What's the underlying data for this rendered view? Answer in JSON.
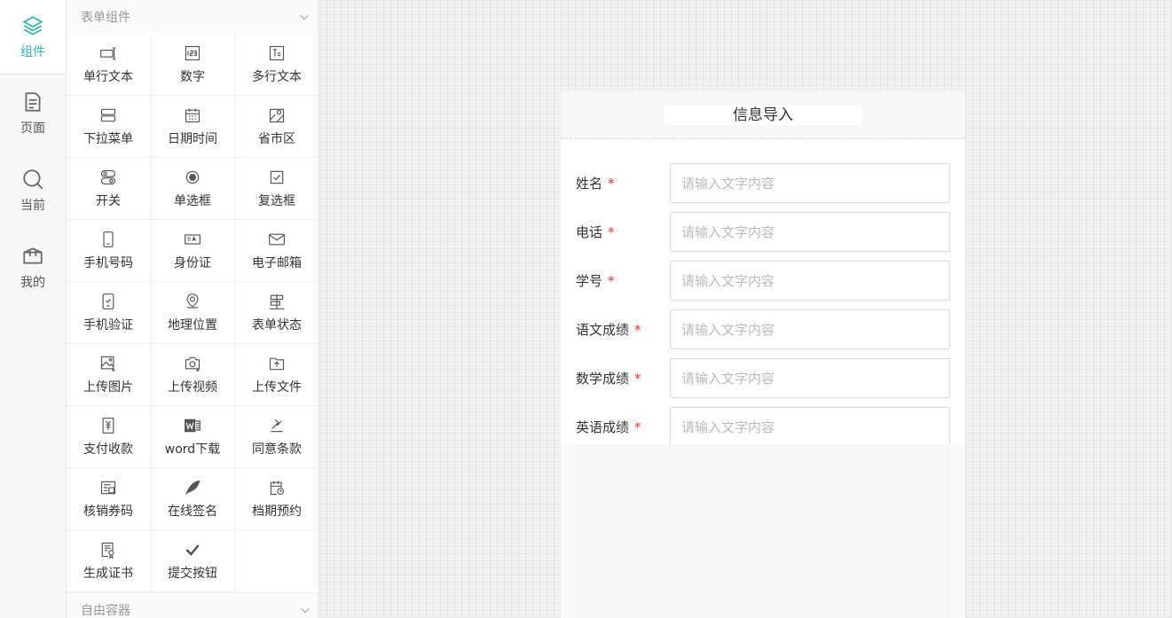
{
  "rail": {
    "items": [
      {
        "label": "组件",
        "icon": "layers-icon",
        "active": true
      },
      {
        "label": "页面",
        "icon": "page-icon",
        "active": false
      },
      {
        "label": "当前",
        "icon": "search-icon",
        "active": false
      },
      {
        "label": "我的",
        "icon": "box-icon",
        "active": false
      }
    ]
  },
  "panel": {
    "group_title": "表单组件",
    "bottom_group_title": "自由容器",
    "components": [
      {
        "label": "单行文本",
        "icon": "single-line-text-icon"
      },
      {
        "label": "数字",
        "icon": "number-icon"
      },
      {
        "label": "多行文本",
        "icon": "multiline-text-icon"
      },
      {
        "label": "下拉菜单",
        "icon": "dropdown-icon"
      },
      {
        "label": "日期时间",
        "icon": "calendar-icon"
      },
      {
        "label": "省市区",
        "icon": "map-region-icon"
      },
      {
        "label": "开关",
        "icon": "switch-icon"
      },
      {
        "label": "单选框",
        "icon": "radio-icon"
      },
      {
        "label": "复选框",
        "icon": "checkbox-icon"
      },
      {
        "label": "手机号码",
        "icon": "mobile-icon"
      },
      {
        "label": "身份证",
        "icon": "id-card-icon"
      },
      {
        "label": "电子邮箱",
        "icon": "mail-icon"
      },
      {
        "label": "手机验证",
        "icon": "phone-verify-icon"
      },
      {
        "label": "地理位置",
        "icon": "location-icon"
      },
      {
        "label": "表单状态",
        "icon": "form-status-icon"
      },
      {
        "label": "上传图片",
        "icon": "image-upload-icon"
      },
      {
        "label": "上传视频",
        "icon": "video-upload-icon"
      },
      {
        "label": "上传文件",
        "icon": "file-upload-icon"
      },
      {
        "label": "支付收款",
        "icon": "payment-icon"
      },
      {
        "label": "word下载",
        "icon": "word-icon"
      },
      {
        "label": "同意条款",
        "icon": "agree-terms-icon"
      },
      {
        "label": "核销券码",
        "icon": "coupon-icon"
      },
      {
        "label": "在线签名",
        "icon": "feather-icon"
      },
      {
        "label": "档期预约",
        "icon": "schedule-icon"
      },
      {
        "label": "生成证书",
        "icon": "certificate-icon"
      },
      {
        "label": "提交按钮",
        "icon": "check-icon"
      }
    ]
  },
  "form": {
    "title": "信息导入",
    "placeholder": "请输入文字内容",
    "required_mark": "*",
    "fields": [
      {
        "label": "姓名",
        "value": ""
      },
      {
        "label": "电话",
        "value": ""
      },
      {
        "label": "学号",
        "value": ""
      },
      {
        "label": "语文成绩",
        "value": ""
      },
      {
        "label": "数学成绩",
        "value": ""
      },
      {
        "label": "英语成绩",
        "value": ""
      }
    ]
  },
  "colors": {
    "accent": "#35b2a6",
    "required": "#e33333"
  }
}
